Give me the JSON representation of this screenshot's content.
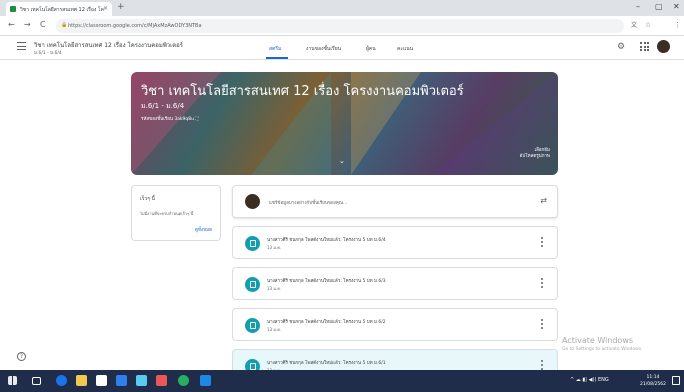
{
  "browser": {
    "tab_title": "วิชา เทคโนโลยีสารสนเทศ 12 เรื่อง โค",
    "tab_close": "×",
    "new_tab": "+",
    "url": "https://classroom.google.com/c/MjAxMzAwODY3NTBa",
    "nav_back": "←",
    "nav_forward": "→",
    "nav_reload": "C",
    "lock": "🔒",
    "window_min": "–",
    "window_max": "▢",
    "window_close": "✕"
  },
  "header": {
    "course_name": "วิชา เทคโนโลยีสารสนเทศ 12 เรื่อง โครงงานคอมพิวเตอร์",
    "course_section": "ม.6/1 - ม.6/4",
    "tabs": [
      {
        "label": "สตรีม"
      },
      {
        "label": "งานของชั้นเรียน"
      },
      {
        "label": "ผู้คน"
      },
      {
        "label": "คะแนน"
      }
    ],
    "settings_glyph": "⚙"
  },
  "banner": {
    "title": "วิชา เทคโนโลยีสารสนเทศ 12 เรื่อง โครงงานคอมพิวเตอร์",
    "subtitle": "ม.6/1 - ม.6/4",
    "class_code_label": "รหัสของชั้นเรียน 3ak9q8u ⛶",
    "chevron": "⌄",
    "select_theme_line1": "เลือกธีม",
    "select_theme_line2": "อัปโหลดรูปภาพ"
  },
  "upcoming": {
    "title": "เร็วๆ นี้",
    "empty_text": "ไม่มีงานที่จะครบกำหนดเร็วๆ นี้",
    "view_all": "ดูทั้งหมด"
  },
  "share": {
    "placeholder": "แชร์ข้อมูลบางอย่างกับชั้นเรียนของคุณ...",
    "repost_glyph": "⇄"
  },
  "posts": [
    {
      "text": "นางสาวศิริ ชนกกุล โพสต์งานใหม่แล้ว: โครงงาน 5 บท ม.6/4",
      "date": "13 ม.ค."
    },
    {
      "text": "นางสาวศิริ ชนกกุล โพสต์งานใหม่แล้ว: โครงงาน 5 บท ม.6/3",
      "date": "13 ม.ค."
    },
    {
      "text": "นางสาวศิริ ชนกกุล โพสต์งานใหม่แล้ว: โครงงาน 5 บท ม.6/2",
      "date": "13 ม.ค."
    },
    {
      "text": "นางสาวศิริ ชนกกุล โพสต์งานใหม่แล้ว: โครงงาน 5 บท ม.6/1",
      "date": "13 ม.ค."
    }
  ],
  "help": {
    "glyph": "?"
  },
  "watermark": {
    "line1": "Activate Windows",
    "line2": "Go to Settings to activate Windows."
  },
  "taskbar": {
    "time": "11:14",
    "date": "21/08/2562",
    "tray": "^ ☁ ◧ ◀)) ENG"
  },
  "colors": {
    "accent": "#1967d2",
    "post_icon": "#129eaf",
    "taskbar": "#1f2d4a"
  }
}
